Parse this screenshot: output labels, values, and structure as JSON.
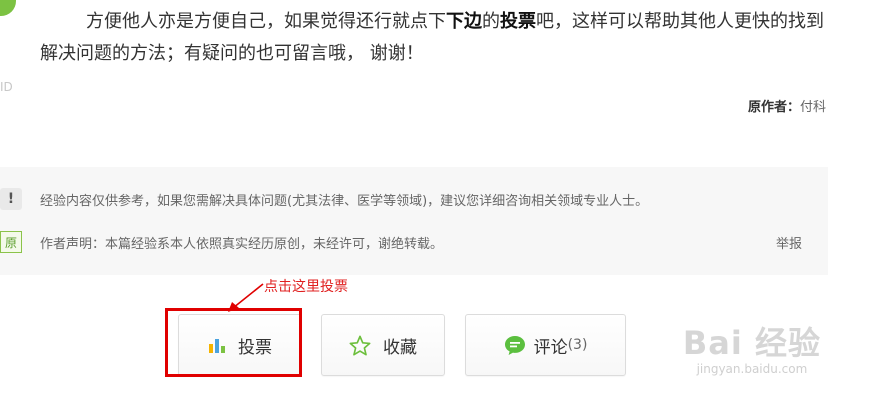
{
  "paragraph": {
    "part1": "方便他人亦是方便自己，如果觉得还行就点下",
    "bold1": "下边",
    "part2": "的",
    "bold2": "投票",
    "part3": "吧，这样可以帮助其他人更快的找到解决问题的方法；有疑问的也可留言哦， 谢谢！"
  },
  "edge_text": "ID",
  "author": {
    "label": "原作者：",
    "name": "付科"
  },
  "notice": {
    "disclaimer_icon": "!",
    "disclaimer": "经验内容仅供参考，如果您需解决具体问题(尤其法律、医学等领域)，建议您详细咨询相关领域专业人士。",
    "original_icon": "原",
    "statement": "作者声明：本篇经验系本人依照真实经历原创，未经许可，谢绝转载。",
    "report": "举报"
  },
  "annotation": {
    "text": "点击这里投票",
    "color": "#e00000"
  },
  "buttons": {
    "vote": "投票",
    "favorite": "收藏",
    "comment": "评论",
    "comment_count": "(3)"
  },
  "watermark": {
    "logo": "Bai 经验",
    "url": "jingyan.baidu.com"
  },
  "colors": {
    "accent_green": "#7cc242",
    "annotation_red": "#e00000"
  }
}
